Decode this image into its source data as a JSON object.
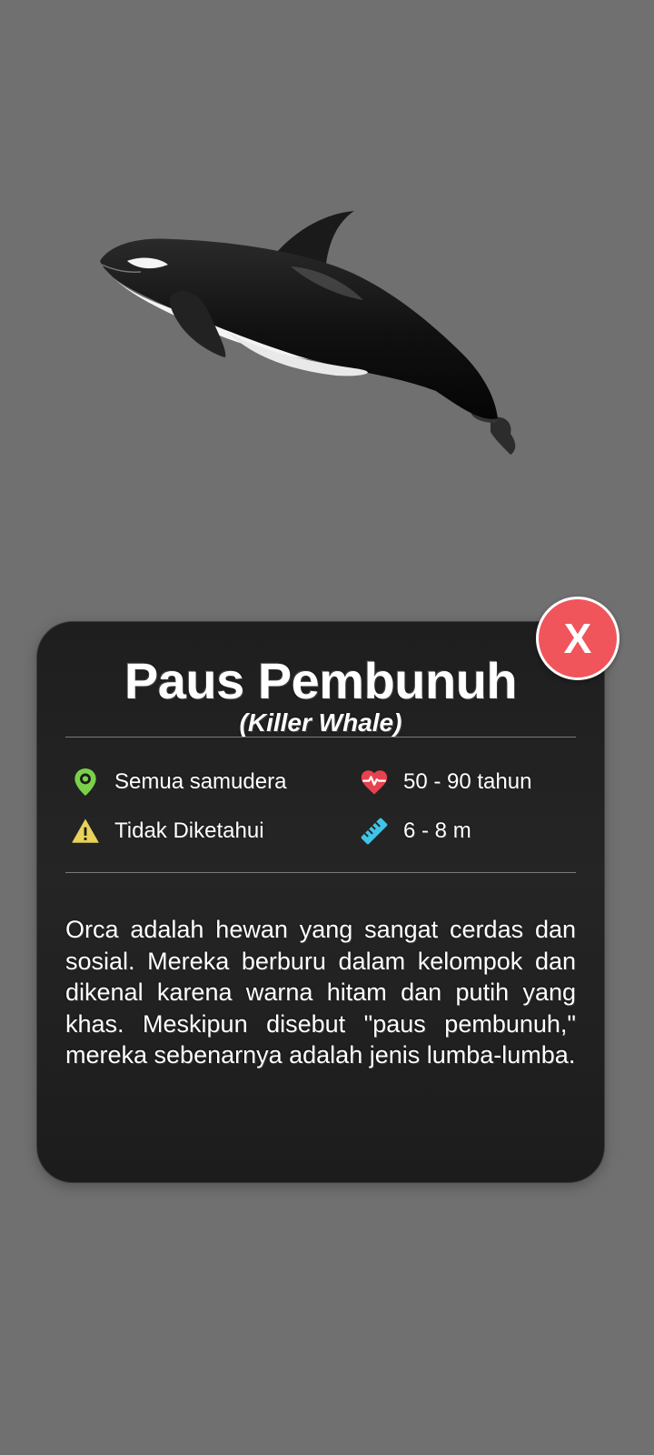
{
  "animal": {
    "name": "Paus Pembunuh",
    "scientific_name": "(Killer Whale)",
    "image_icon": "orca-illustration"
  },
  "close_button": {
    "label": "X",
    "color": "#f0555b"
  },
  "stats": {
    "habitat": {
      "icon": "location-pin-icon",
      "value": "Semua samudera",
      "color": "#7bd04a"
    },
    "lifespan": {
      "icon": "heart-pulse-icon",
      "value": "50 - 90 tahun",
      "color": "#e8424f"
    },
    "status": {
      "icon": "warning-icon",
      "value": "Tidak Diketahui",
      "color": "#e7d25a"
    },
    "size": {
      "icon": "ruler-icon",
      "value": "6 - 8 m",
      "color": "#3ec4e6"
    }
  },
  "description": "Orca adalah hewan yang sangat cerdas dan sosial. Mereka berburu dalam kelompok dan dikenal karena warna hitam dan putih yang khas. Meskipun disebut \"paus pembunuh,\" mereka sebenarnya adalah jenis lumba-lumba."
}
